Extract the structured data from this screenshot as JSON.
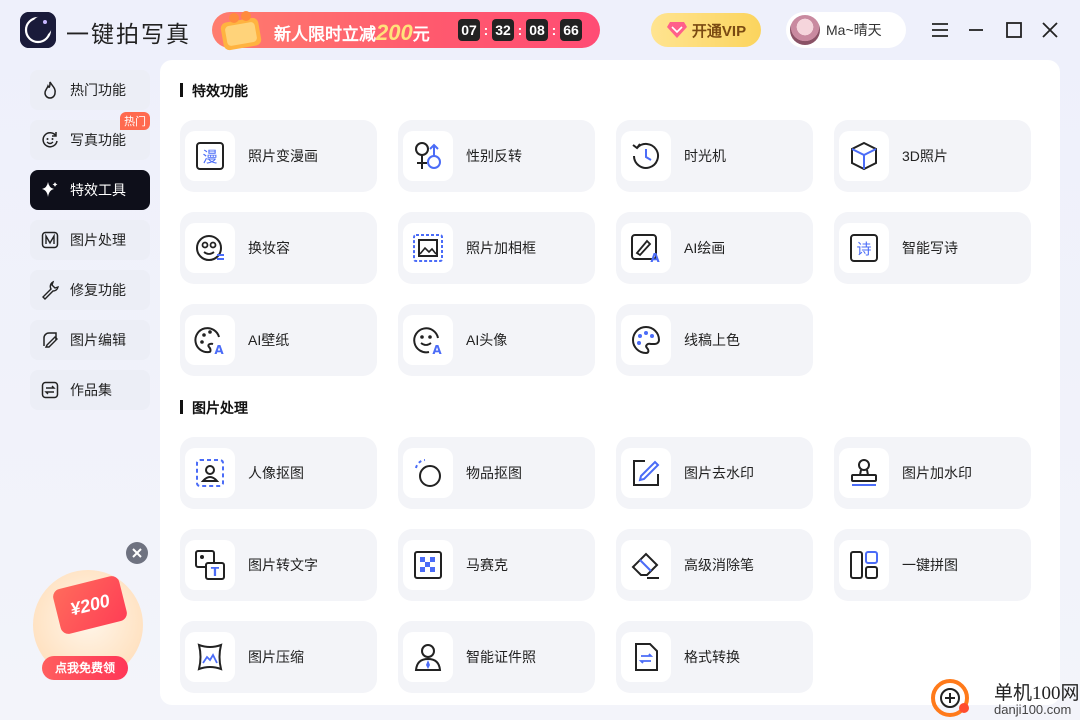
{
  "app": {
    "title": "一键拍写真"
  },
  "promo": {
    "text_prefix": "新人限时立减",
    "amount": "200",
    "unit": "元",
    "countdown": [
      "07",
      "32",
      "08",
      "66"
    ]
  },
  "vip": {
    "label": "开通VIP"
  },
  "user": {
    "name": "Ma~晴天"
  },
  "sidebar": {
    "items": [
      {
        "label": "热门功能",
        "icon": "flame-icon"
      },
      {
        "label": "写真功能",
        "icon": "smile-refresh-icon",
        "badge": "热门"
      },
      {
        "label": "特效工具",
        "icon": "sparkle-icon",
        "active": true
      },
      {
        "label": "图片处理",
        "icon": "image-process-icon"
      },
      {
        "label": "修复功能",
        "icon": "wrench-icon"
      },
      {
        "label": "图片编辑",
        "icon": "edit-image-icon"
      },
      {
        "label": "作品集",
        "icon": "swap-box-icon"
      }
    ]
  },
  "coupon": {
    "amount": "¥200",
    "button": "点我免费领"
  },
  "sections": [
    {
      "title": "特效功能",
      "items": [
        {
          "label": "照片变漫画",
          "icon": "manga-icon"
        },
        {
          "label": "性别反转",
          "icon": "gender-icon"
        },
        {
          "label": "时光机",
          "icon": "history-clock-icon"
        },
        {
          "label": "3D照片",
          "icon": "cube-icon"
        },
        {
          "label": "换妆容",
          "icon": "makeup-face-icon"
        },
        {
          "label": "照片加相框",
          "icon": "photo-frame-icon"
        },
        {
          "label": "AI绘画",
          "icon": "ai-paint-icon"
        },
        {
          "label": "智能写诗",
          "icon": "poem-icon"
        },
        {
          "label": "AI壁纸",
          "icon": "ai-wallpaper-icon"
        },
        {
          "label": "AI头像",
          "icon": "ai-avatar-icon"
        },
        {
          "label": "线稿上色",
          "icon": "palette-icon"
        }
      ]
    },
    {
      "title": "图片处理",
      "items": [
        {
          "label": "人像抠图",
          "icon": "portrait-cutout-icon"
        },
        {
          "label": "物品抠图",
          "icon": "object-cutout-icon"
        },
        {
          "label": "图片去水印",
          "icon": "remove-watermark-icon"
        },
        {
          "label": "图片加水印",
          "icon": "stamp-icon"
        },
        {
          "label": "图片转文字",
          "icon": "image-to-text-icon"
        },
        {
          "label": "马赛克",
          "icon": "mosaic-icon"
        },
        {
          "label": "高级消除笔",
          "icon": "eraser-icon"
        },
        {
          "label": "一键拼图",
          "icon": "collage-icon"
        },
        {
          "label": "图片压缩",
          "icon": "compress-icon"
        },
        {
          "label": "智能证件照",
          "icon": "id-photo-icon"
        },
        {
          "label": "格式转换",
          "icon": "format-convert-icon"
        }
      ]
    }
  ],
  "watermark": {
    "title": "单机100网",
    "url": "danji100.com"
  },
  "colors": {
    "accent": "#4b6cf7",
    "dark": "#0e0f1a",
    "promo": "#ff5a6e",
    "vip": "#fbd45e"
  }
}
